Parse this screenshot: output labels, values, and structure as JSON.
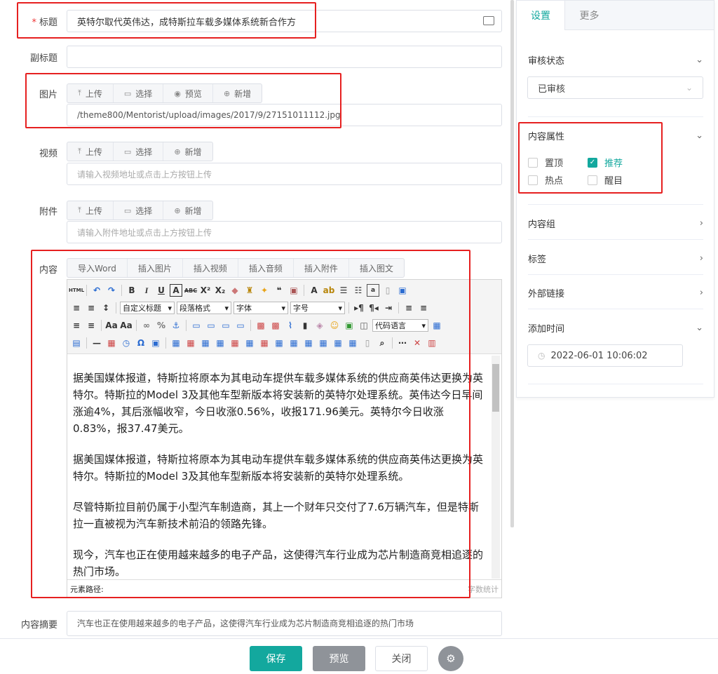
{
  "form": {
    "title": {
      "label": "标题",
      "required_mark": "*",
      "value": "英特尔取代英伟达，成特斯拉车载多媒体系统新合作方"
    },
    "subtitle": {
      "label": "副标题",
      "value": ""
    },
    "image": {
      "label": "图片",
      "buttons": [
        "上传",
        "选择",
        "预览",
        "新增"
      ],
      "value": "/theme800/Mentorist/upload/images/2017/9/27151011112.jpg"
    },
    "video": {
      "label": "视频",
      "buttons": [
        "上传",
        "选择",
        "新增"
      ],
      "placeholder": "请输入视频地址或点击上方按钮上传"
    },
    "attachment": {
      "label": "附件",
      "buttons": [
        "上传",
        "选择",
        "新增"
      ],
      "placeholder": "请输入附件地址或点击上方按钮上传"
    },
    "content": {
      "label": "内容",
      "insert_buttons": [
        "导入Word",
        "插入图片",
        "插入视频",
        "插入音频",
        "插入附件",
        "插入图文"
      ],
      "toolbar_selects": {
        "heading": "自定义标题",
        "paragraph": "段落格式",
        "font": "字体",
        "size": "字号",
        "code": "代码语言"
      },
      "paragraphs": [
        "据美国媒体报道，特斯拉将原本为其电动车提供车载多媒体系统的供应商英伟达更换为英特尔。特斯拉的Model 3及其他车型新版本将安装新的英特尔处理系统。英伟达今日早间涨逾4%，其后涨幅收窄，今日收涨0.56%，收报171.96美元。英特尔今日收涨0.83%，报37.47美元。",
        "据美国媒体报道，特斯拉将原本为其电动车提供车载多媒体系统的供应商英伟达更换为英特尔。特斯拉的Model 3及其他车型新版本将安装新的英特尔处理系统。",
        "尽管特斯拉目前仍属于小型汽车制造商，其上一个财年只交付了7.6万辆汽车，但是特斯拉一直被视为汽车新技术前沿的领路先锋。",
        "现今，汽车也正在使用越来越多的电子产品，这使得汽车行业成为芯片制造商竞相追逐的热门市场。"
      ],
      "element_path": "元素路径:",
      "word_count": "字数统计"
    },
    "summary": {
      "label": "内容摘要",
      "value": "汽车也正在使用越来越多的电子产品，这使得汽车行业成为芯片制造商竞相追逐的热门市场"
    }
  },
  "sidebar": {
    "tabs": [
      "设置",
      "更多"
    ],
    "review": {
      "label": "审核状态",
      "value": "已审核"
    },
    "attributes": {
      "label": "内容属性",
      "items": [
        {
          "label": "置顶",
          "checked": false
        },
        {
          "label": "推荐",
          "checked": true
        },
        {
          "label": "热点",
          "checked": false
        },
        {
          "label": "醒目",
          "checked": false
        }
      ]
    },
    "group": {
      "label": "内容组"
    },
    "tags": {
      "label": "标签"
    },
    "external": {
      "label": "外部链接"
    },
    "time": {
      "label": "添加时间",
      "value": "2022-06-01 10:06:02"
    }
  },
  "footer": {
    "save": "保存",
    "preview": "预览",
    "close": "关闭"
  },
  "colors": {
    "accent": "#13a89e",
    "highlight": "#e62020",
    "preview_btn": "#8f9399"
  }
}
